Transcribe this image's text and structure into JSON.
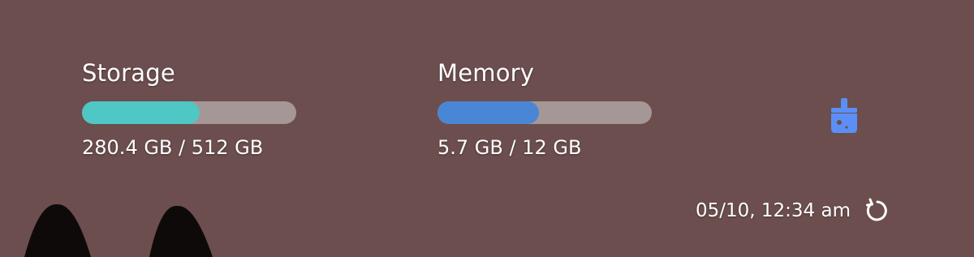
{
  "storage": {
    "title": "Storage",
    "value_text": "280.4 GB / 512 GB",
    "used_gb": 280.4,
    "total_gb": 512,
    "fraction": 0.5476,
    "bar_color": "#4fc7c5"
  },
  "memory": {
    "title": "Memory",
    "value_text": "5.7 GB / 12 GB",
    "used_gb": 5.7,
    "total_gb": 12,
    "fraction": 0.475,
    "bar_color": "#4a86d6"
  },
  "clean_button": {
    "icon": "broom-icon",
    "color": "#5b8ff5"
  },
  "footer": {
    "timestamp": "05/10, 12:34 am",
    "refresh_icon": "refresh-icon"
  },
  "colors": {
    "background": "#6b4e4d",
    "track": "#a59796",
    "text": "#ffffff"
  }
}
